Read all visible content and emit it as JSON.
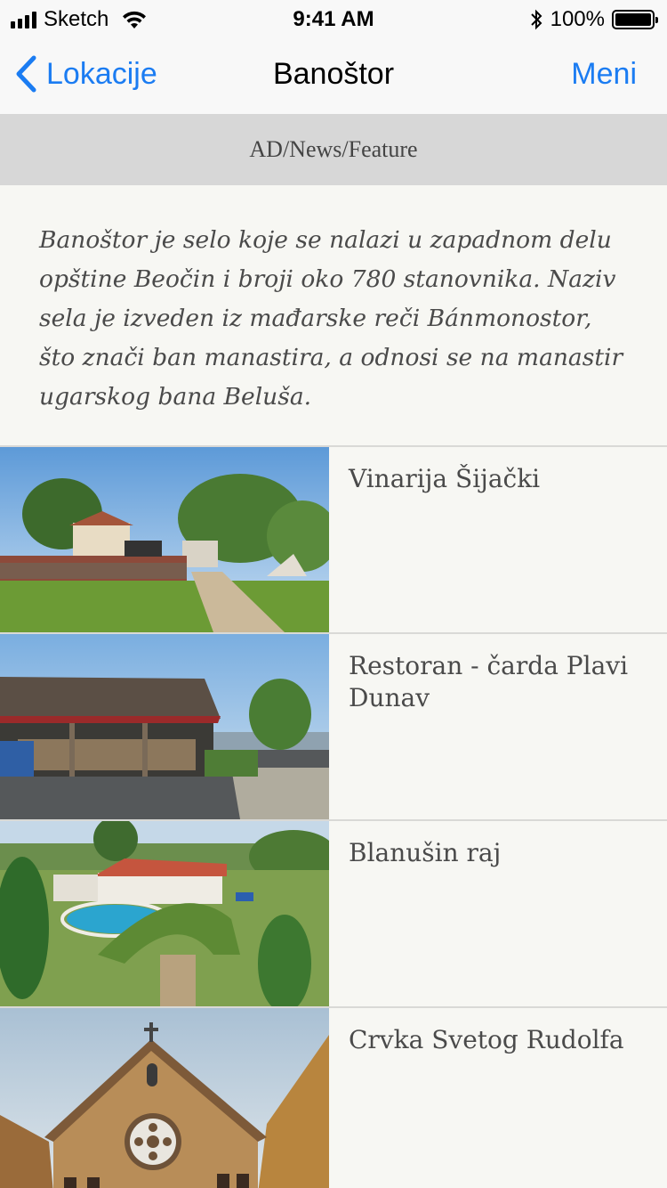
{
  "status_bar": {
    "carrier": "Sketch",
    "time": "9:41 AM",
    "battery_percent": "100%",
    "battery_level": 1.0
  },
  "nav": {
    "back_label": "Lokacije",
    "title": "Banoštor",
    "menu_label": "Meni"
  },
  "ad": {
    "label": "AD/News/Feature"
  },
  "intro": {
    "text": "Banoštor je selo koje se nalazi u zapadnom delu opštine Beočin i broji oko 780 stanovnika. Naziv sela je izveden iz mađarske reči Bánmonostor, što znači ban manastira, a odnosi se na manastir ugarskog bana Beluša."
  },
  "locations": [
    {
      "title": "Vinarija Šijački",
      "image": "winery-photo"
    },
    {
      "title": "Restoran - čarda Plavi Dunav",
      "image": "restaurant-photo"
    },
    {
      "title": "Blanušin raj",
      "image": "pool-garden-photo"
    },
    {
      "title": "Crvka Svetog Rudolfa",
      "image": "church-photo"
    }
  ],
  "colors": {
    "accent": "#1b7cf2",
    "background": "#f7f7f3",
    "ad_background": "#d7d7d7",
    "text_gray": "#4a4a4a"
  }
}
